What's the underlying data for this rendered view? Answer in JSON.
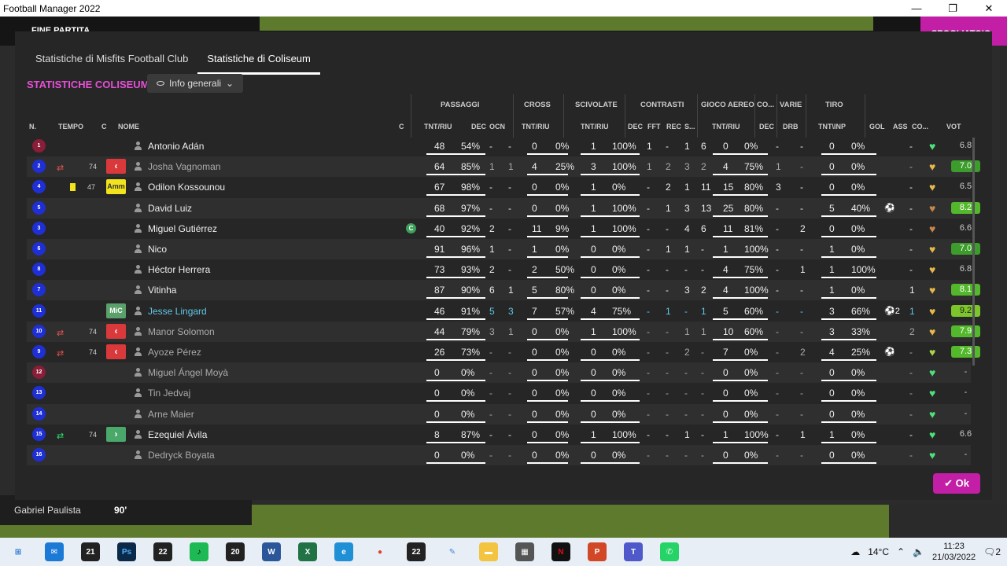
{
  "window": {
    "title": "Football Manager 2022",
    "min": "—",
    "max": "❐",
    "close": "✕"
  },
  "gamebar": {
    "status": "FINE PARTITA",
    "reject": "SPOGLIATOIO"
  },
  "bottom": {
    "player": "Gabriel Paulista",
    "minute": "90'"
  },
  "modal": {
    "tabs": [
      "Statistiche di Misfits Football Club",
      "Statistiche di Coliseum"
    ],
    "section_title": "STATISTICHE COLISEUM",
    "dropdown": "Info generali",
    "groups": [
      "PASSAGGI",
      "CROSS",
      "SCIVOLATE",
      "CONTRASTI",
      "GIOCO AEREO",
      "CO...",
      "VARIE",
      "TIRO"
    ],
    "headers": [
      "N.",
      "TEMPO",
      "C",
      "NOME",
      "C",
      "TNT/RIU",
      "DEC",
      "OCN",
      "TNT/RIU",
      "TNT/RIU",
      "DEC",
      "FFT",
      "REC",
      "S...",
      "TNT/RIU",
      "DEC",
      "DRB",
      "TNT\\INP",
      "GOL",
      "ASS",
      "CO...",
      "VOT"
    ],
    "ok": "Ok"
  },
  "players": [
    {
      "n": "1",
      "gk": true,
      "name": "Antonio Adán",
      "p": [
        "48",
        "54%"
      ],
      "dec": "-",
      "ocn": "-",
      "cr": [
        "0",
        "0%"
      ],
      "sc": [
        "1",
        "100%"
      ],
      "cd": "1",
      "fft": "-",
      "rec": "1",
      "s": "6",
      "ga": [
        "0",
        "0%"
      ],
      "co": "-",
      "drb": "-",
      "sh": [
        "0",
        "0%"
      ],
      "gol": "",
      "ass": "-",
      "vot": "6.8",
      "heart": "#4ee07a"
    },
    {
      "n": "2",
      "out": true,
      "mins": "74",
      "role": "out",
      "name": "Josha Vagnoman",
      "dim": true,
      "p": [
        "64",
        "85%"
      ],
      "dec": "1",
      "ocn": "1",
      "cr": [
        "4",
        "25%"
      ],
      "sc": [
        "3",
        "100%"
      ],
      "cd": "1",
      "fft": "2",
      "rec": "3",
      "s": "2",
      "ga": [
        "4",
        "75%"
      ],
      "co": "1",
      "drb": "-",
      "sh": [
        "0",
        "0%"
      ],
      "gol": "",
      "ass": "-",
      "vot": "7.0",
      "heart": "#e6b84a"
    },
    {
      "n": "4",
      "yc": true,
      "mins": "47",
      "role": "amm",
      "name": "Odilon Kossounou",
      "p": [
        "67",
        "98%"
      ],
      "dec": "-",
      "ocn": "-",
      "cr": [
        "0",
        "0%"
      ],
      "sc": [
        "1",
        "0%"
      ],
      "cd": "-",
      "fft": "2",
      "rec": "1",
      "s": "11",
      "ga": [
        "15",
        "80%"
      ],
      "co": "3",
      "drb": "-",
      "sh": [
        "0",
        "0%"
      ],
      "gol": "",
      "ass": "-",
      "vot": "6.5",
      "heart": "#e6b84a"
    },
    {
      "n": "5",
      "name": "David Luiz",
      "p": [
        "68",
        "97%"
      ],
      "dec": "-",
      "ocn": "-",
      "cr": [
        "0",
        "0%"
      ],
      "sc": [
        "1",
        "100%"
      ],
      "cd": "-",
      "fft": "1",
      "rec": "3",
      "s": "13",
      "ga": [
        "25",
        "80%"
      ],
      "co": "-",
      "drb": "-",
      "sh": [
        "5",
        "40%"
      ],
      "gol": "⚽",
      "ass": "-",
      "vot": "8.2",
      "heart": "#c8874a"
    },
    {
      "n": "3",
      "name": "Miguel Gutiérrez",
      "capt": true,
      "p": [
        "40",
        "92%"
      ],
      "dec": "2",
      "ocn": "-",
      "cr": [
        "11",
        "9%"
      ],
      "sc": [
        "1",
        "100%"
      ],
      "cd": "-",
      "fft": "-",
      "rec": "4",
      "s": "6",
      "ga": [
        "11",
        "81%"
      ],
      "co": "-",
      "drb": "2",
      "sh": [
        "0",
        "0%"
      ],
      "gol": "",
      "ass": "-",
      "vot": "6.6",
      "heart": "#c8874a"
    },
    {
      "n": "6",
      "name": "Nico",
      "p": [
        "91",
        "96%"
      ],
      "dec": "1",
      "ocn": "-",
      "cr": [
        "1",
        "0%"
      ],
      "sc": [
        "0",
        "0%"
      ],
      "cd": "-",
      "fft": "1",
      "rec": "1",
      "s": "-",
      "ga": [
        "1",
        "100%"
      ],
      "co": "-",
      "drb": "-",
      "sh": [
        "1",
        "0%"
      ],
      "gol": "",
      "ass": "-",
      "vot": "7.0",
      "heart": "#e6b84a"
    },
    {
      "n": "8",
      "name": "Héctor Herrera",
      "p": [
        "73",
        "93%"
      ],
      "dec": "2",
      "ocn": "-",
      "cr": [
        "2",
        "50%"
      ],
      "sc": [
        "0",
        "0%"
      ],
      "cd": "-",
      "fft": "-",
      "rec": "-",
      "s": "-",
      "ga": [
        "4",
        "75%"
      ],
      "co": "-",
      "drb": "1",
      "sh": [
        "1",
        "100%"
      ],
      "gol": "",
      "ass": "-",
      "vot": "6.8",
      "heart": "#e6b84a"
    },
    {
      "n": "7",
      "name": "Vitinha",
      "p": [
        "87",
        "90%"
      ],
      "dec": "6",
      "ocn": "1",
      "cr": [
        "5",
        "80%"
      ],
      "sc": [
        "0",
        "0%"
      ],
      "cd": "-",
      "fft": "-",
      "rec": "3",
      "s": "2",
      "ga": [
        "4",
        "100%"
      ],
      "co": "-",
      "drb": "-",
      "sh": [
        "1",
        "0%"
      ],
      "gol": "",
      "ass": "1",
      "vot": "8.1",
      "heart": "#e6b84a"
    },
    {
      "n": "11",
      "role": "mic",
      "name": "Jesse Lingard",
      "link": true,
      "p": [
        "46",
        "91%"
      ],
      "dec": "5",
      "ocn": "3",
      "cr": [
        "7",
        "57%"
      ],
      "sc": [
        "4",
        "75%"
      ],
      "cd": "-",
      "fft": "1",
      "rec": "-",
      "s": "1",
      "ga": [
        "5",
        "60%"
      ],
      "co": "-",
      "drb": "-",
      "sh": [
        "3",
        "66%"
      ],
      "gol": "⚽2",
      "ass": "1",
      "vot": "9.2",
      "heart": "#e6b84a"
    },
    {
      "n": "10",
      "out": true,
      "mins": "74",
      "role": "out",
      "name": "Manor Solomon",
      "dim": true,
      "p": [
        "44",
        "79%"
      ],
      "dec": "3",
      "ocn": "1",
      "cr": [
        "0",
        "0%"
      ],
      "sc": [
        "1",
        "100%"
      ],
      "cd": "-",
      "fft": "-",
      "rec": "1",
      "s": "1",
      "ga": [
        "10",
        "60%"
      ],
      "co": "-",
      "drb": "-",
      "sh": [
        "3",
        "33%"
      ],
      "gol": "",
      "ass": "2",
      "vot": "7.9",
      "heart": "#e6b84a"
    },
    {
      "n": "9",
      "out": true,
      "mins": "74",
      "role": "out",
      "name": "Ayoze Pérez",
      "dim": true,
      "p": [
        "26",
        "73%"
      ],
      "dec": "-",
      "ocn": "-",
      "cr": [
        "0",
        "0%"
      ],
      "sc": [
        "0",
        "0%"
      ],
      "cd": "-",
      "fft": "-",
      "rec": "2",
      "s": "-",
      "ga": [
        "7",
        "0%"
      ],
      "co": "-",
      "drb": "2",
      "sh": [
        "4",
        "25%"
      ],
      "gol": "⚽",
      "ass": "-",
      "vot": "7.3",
      "heart": "#a6d84a"
    },
    {
      "n": "12",
      "gk": true,
      "name": "Miguel Ángel Moyà",
      "dim": true,
      "p": [
        "0",
        "0%"
      ],
      "dec": "-",
      "ocn": "-",
      "cr": [
        "0",
        "0%"
      ],
      "sc": [
        "0",
        "0%"
      ],
      "cd": "-",
      "fft": "-",
      "rec": "-",
      "s": "-",
      "ga": [
        "0",
        "0%"
      ],
      "co": "-",
      "drb": "-",
      "sh": [
        "0",
        "0%"
      ],
      "gol": "",
      "ass": "-",
      "vot": "-",
      "heart": "#4ee07a"
    },
    {
      "n": "13",
      "name": "Tin Jedvaj",
      "dim": true,
      "p": [
        "0",
        "0%"
      ],
      "dec": "-",
      "ocn": "-",
      "cr": [
        "0",
        "0%"
      ],
      "sc": [
        "0",
        "0%"
      ],
      "cd": "-",
      "fft": "-",
      "rec": "-",
      "s": "-",
      "ga": [
        "0",
        "0%"
      ],
      "co": "-",
      "drb": "-",
      "sh": [
        "0",
        "0%"
      ],
      "gol": "",
      "ass": "-",
      "vot": "-",
      "heart": "#4ee07a"
    },
    {
      "n": "14",
      "name": "Arne Maier",
      "dim": true,
      "p": [
        "0",
        "0%"
      ],
      "dec": "-",
      "ocn": "-",
      "cr": [
        "0",
        "0%"
      ],
      "sc": [
        "0",
        "0%"
      ],
      "cd": "-",
      "fft": "-",
      "rec": "-",
      "s": "-",
      "ga": [
        "0",
        "0%"
      ],
      "co": "-",
      "drb": "-",
      "sh": [
        "0",
        "0%"
      ],
      "gol": "",
      "ass": "-",
      "vot": "-",
      "heart": "#4ee07a"
    },
    {
      "n": "15",
      "in": true,
      "mins": "74",
      "role": "in",
      "name": "Ezequiel Ávila",
      "p": [
        "8",
        "87%"
      ],
      "dec": "-",
      "ocn": "-",
      "cr": [
        "0",
        "0%"
      ],
      "sc": [
        "1",
        "100%"
      ],
      "cd": "-",
      "fft": "-",
      "rec": "1",
      "s": "-",
      "ga": [
        "1",
        "100%"
      ],
      "co": "-",
      "drb": "1",
      "sh": [
        "1",
        "0%"
      ],
      "gol": "",
      "ass": "-",
      "vot": "6.6",
      "heart": "#4ee07a"
    },
    {
      "n": "16",
      "name": "Dedryck Boyata",
      "dim": true,
      "p": [
        "0",
        "0%"
      ],
      "dec": "-",
      "ocn": "-",
      "cr": [
        "0",
        "0%"
      ],
      "sc": [
        "0",
        "0%"
      ],
      "cd": "-",
      "fft": "-",
      "rec": "-",
      "s": "-",
      "ga": [
        "0",
        "0%"
      ],
      "co": "-",
      "drb": "-",
      "sh": [
        "0",
        "0%"
      ],
      "gol": "",
      "ass": "-",
      "vot": "-",
      "heart": "#4ee07a"
    }
  ],
  "taskbar": {
    "icons": [
      {
        "name": "start-icon",
        "label": "⊞",
        "bg": "#e8eef5",
        "fg": "#1a6fd0"
      },
      {
        "name": "mail-icon",
        "label": "✉",
        "bg": "#1a7ad6",
        "fg": "#fff"
      },
      {
        "name": "fm21-icon",
        "label": "21",
        "bg": "#222",
        "fg": "#fff"
      },
      {
        "name": "photoshop-icon",
        "label": "Ps",
        "bg": "#0b2a4a",
        "fg": "#4cb0ff"
      },
      {
        "name": "fm22-icon",
        "label": "22",
        "bg": "#222",
        "fg": "#fff"
      },
      {
        "name": "spotify-icon",
        "label": "♪",
        "bg": "#1db954",
        "fg": "#000"
      },
      {
        "name": "fm20-icon",
        "label": "20",
        "bg": "#222",
        "fg": "#fff"
      },
      {
        "name": "word-icon",
        "label": "W",
        "bg": "#2b579a",
        "fg": "#fff"
      },
      {
        "name": "excel-icon",
        "label": "X",
        "bg": "#217346",
        "fg": "#fff"
      },
      {
        "name": "edge-icon",
        "label": "e",
        "bg": "#1f8fd6",
        "fg": "#fff"
      },
      {
        "name": "chrome-icon",
        "label": "●",
        "bg": "#e8eef5",
        "fg": "#e04030"
      },
      {
        "name": "fm22-active-icon",
        "label": "22",
        "bg": "#222",
        "fg": "#fff"
      },
      {
        "name": "paint-icon",
        "label": "✎",
        "bg": "#e8eef5",
        "fg": "#3a8ad6"
      },
      {
        "name": "explorer-icon",
        "label": "▬",
        "bg": "#f3c440",
        "fg": "#fff"
      },
      {
        "name": "calculator-icon",
        "label": "▦",
        "bg": "#555",
        "fg": "#fff"
      },
      {
        "name": "netflix-icon",
        "label": "N",
        "bg": "#111",
        "fg": "#e50914"
      },
      {
        "name": "powerpoint-icon",
        "label": "P",
        "bg": "#d24726",
        "fg": "#fff"
      },
      {
        "name": "teams-icon",
        "label": "T",
        "bg": "#5059c9",
        "fg": "#fff"
      },
      {
        "name": "whatsapp-icon",
        "label": "✆",
        "bg": "#25d366",
        "fg": "#fff"
      }
    ],
    "weather": "14°C",
    "time": "11:23",
    "date": "21/03/2022",
    "notif": "2"
  }
}
